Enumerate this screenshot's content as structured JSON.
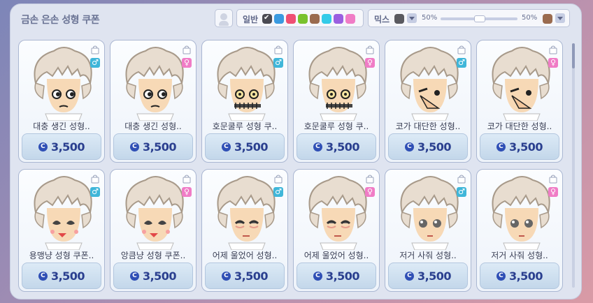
{
  "window": {
    "title": "금손 은손 성형 쿠폰"
  },
  "filters": {
    "color_label": "일반",
    "swatches": [
      "#4a4a52",
      "#3a9ae0",
      "#ef4f73",
      "#79c22d",
      "#9a6b4f",
      "#34cbe8",
      "#9a5fe0",
      "#f07cc6"
    ],
    "mix_label": "믹스",
    "mix_color_left": "#5a5a60",
    "mix_pct_left": "50%",
    "mix_pct_right": "50%",
    "mix_color_right": "#9a6b4f",
    "slider_value": 0.5
  },
  "items": [
    {
      "name": "대충 생긴 성형..",
      "gender": "male",
      "gender_symbol": "♂",
      "price": "3,500",
      "face": "normal"
    },
    {
      "name": "대충 생긴 성형..",
      "gender": "female",
      "gender_symbol": "♀",
      "price": "3,500",
      "face": "normal"
    },
    {
      "name": "호문쿨루 성형 쿠..",
      "gender": "male",
      "gender_symbol": "♂",
      "price": "3,500",
      "face": "stitch"
    },
    {
      "name": "호문쿨루 성형 쿠..",
      "gender": "female",
      "gender_symbol": "♀",
      "price": "3,500",
      "face": "stitch"
    },
    {
      "name": "코가 대단한 성형..",
      "gender": "male",
      "gender_symbol": "♂",
      "price": "3,500",
      "face": "nose"
    },
    {
      "name": "코가 대단한 성형..",
      "gender": "female",
      "gender_symbol": "♀",
      "price": "3,500",
      "face": "nose"
    },
    {
      "name": "용맹냥 성형 쿠폰..",
      "gender": "male",
      "gender_symbol": "♂",
      "price": "3,500",
      "face": "cat"
    },
    {
      "name": "앙큼냥 성형 쿠폰..",
      "gender": "female",
      "gender_symbol": "♀",
      "price": "3,500",
      "face": "cat"
    },
    {
      "name": "어제 울었어 성형..",
      "gender": "male",
      "gender_symbol": "♂",
      "price": "3,500",
      "face": "cry"
    },
    {
      "name": "어제 울었어 성형..",
      "gender": "female",
      "gender_symbol": "♀",
      "price": "3,500",
      "face": "cry"
    },
    {
      "name": "저거 사줘 성형..",
      "gender": "male",
      "gender_symbol": "♂",
      "price": "3,500",
      "face": "beg"
    },
    {
      "name": "저거 사줘 성형..",
      "gender": "female",
      "gender_symbol": "♀",
      "price": "3,500",
      "face": "beg"
    }
  ],
  "currency_icon": "C"
}
